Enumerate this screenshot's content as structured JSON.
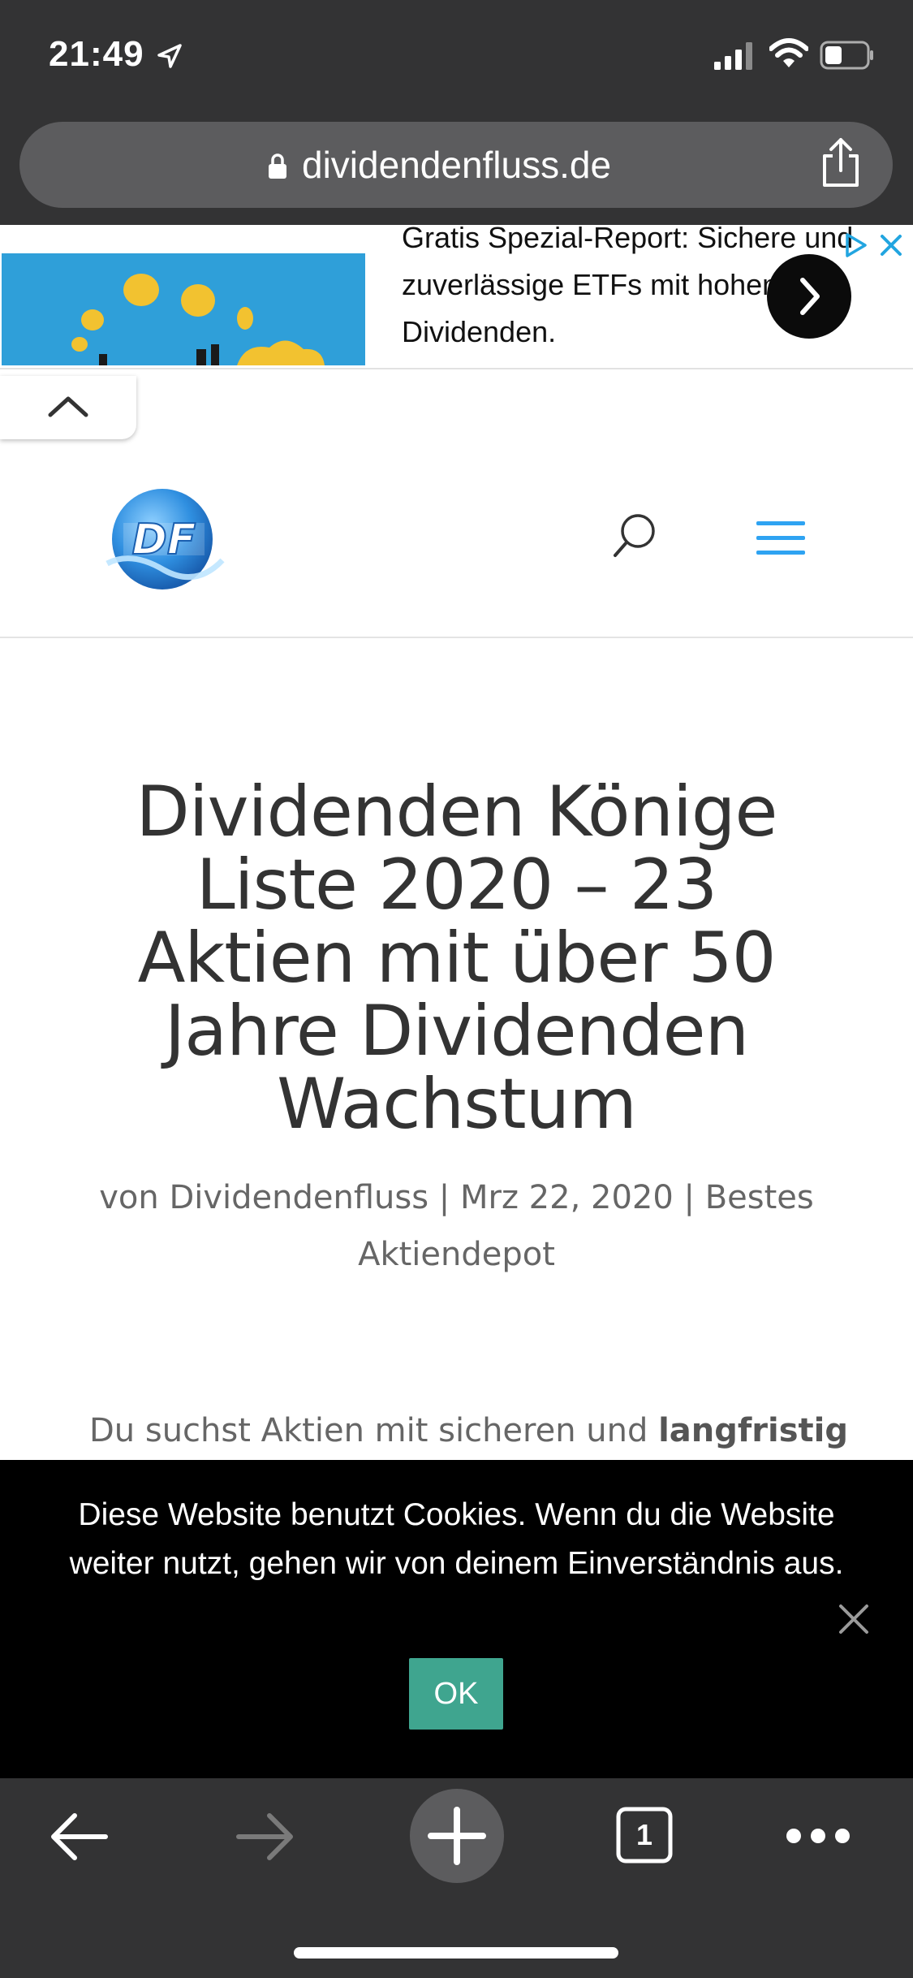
{
  "status_bar": {
    "time": "21:49",
    "icons": [
      "location-arrow-icon",
      "signal-icon",
      "wifi-icon",
      "battery-icon"
    ]
  },
  "url_bar": {
    "domain": "dividendenfluss.de",
    "icons": [
      "lock-icon",
      "share-icon"
    ]
  },
  "ad": {
    "text": "Gratis Spezial-Report: Sichere und zuverlässige ETFs mit hohen Dividenden.",
    "icons": [
      "ad-choices-icon",
      "ad-close-icon",
      "chevron-right-icon",
      "chevron-up-icon"
    ]
  },
  "site_header": {
    "logo_text": "DF",
    "icons": [
      "search-icon",
      "hamburger-menu-icon"
    ]
  },
  "article": {
    "title": "Dividenden Könige Liste 2020 – 23 Aktien mit über 50 Jahre Dividenden Wachstum",
    "meta_author": "von Dividendenfluss",
    "meta_separator_1": "|",
    "meta_date": "Mrz 22, 2020",
    "meta_separator_2": "|",
    "meta_category": "Bestes Aktiendepot",
    "intro_start": "Du suchst Aktien mit sicheren und",
    "intro_bold": "langfristig"
  },
  "cookie_banner": {
    "message": "Diese Website benutzt Cookies. Wenn du die Website weiter nutzt, gehen wir von deinem Einverständnis aus.",
    "ok_label": "OK"
  },
  "toolbar": {
    "tab_count": "1",
    "icons": [
      "back-arrow-icon",
      "forward-arrow-icon",
      "new-tab-plus-icon",
      "tabs-icon",
      "more-icon"
    ]
  },
  "colors": {
    "chrome": "#333334",
    "url_pill": "#5c5c5e",
    "menu_accent": "#2ea3f2",
    "ok_button": "#3fa58f",
    "cookie_bg": "#000000"
  }
}
